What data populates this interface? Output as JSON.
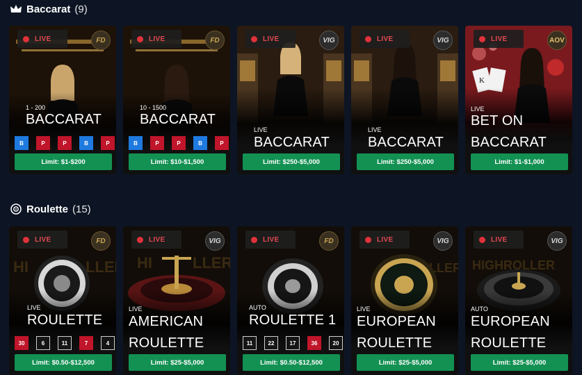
{
  "sections": {
    "baccarat": {
      "title": "Baccarat",
      "count": "(9)"
    },
    "roulette": {
      "title": "Roulette",
      "count": "(15)"
    }
  },
  "live_label": "LIVE",
  "baccarat_cards": [
    {
      "provider": "FD",
      "limit_line": "1 - 200",
      "name": "BACCARAT",
      "chips": [
        "B",
        "P",
        "P",
        "B",
        "P"
      ],
      "limit_button": "Limit: $1-$200"
    },
    {
      "provider": "FD",
      "limit_line": "10 - 1500",
      "name": "BACCARAT",
      "chips": [
        "B",
        "P",
        "P",
        "B",
        "P"
      ],
      "limit_button": "Limit: $10-$1,500"
    },
    {
      "provider": "VIG",
      "tag": "LIVE",
      "name": "BACCARAT",
      "limit_button": "Limit: $250-$5,000"
    },
    {
      "provider": "VIG",
      "tag": "LIVE",
      "name": "BACCARAT",
      "limit_button": "Limit: $250-$5,000"
    },
    {
      "provider": "AOV",
      "tag": "LIVE",
      "name_line1": "BET ON",
      "name_line2": "BACCARAT",
      "limit_button": "Limit: $1-$1,000"
    }
  ],
  "roulette_cards": [
    {
      "provider": "FD",
      "tag": "LIVE",
      "name": "ROULETTE",
      "numbers": [
        "30",
        "6",
        "11",
        "7",
        "4"
      ],
      "limit_button": "Limit: $0.50-$12,500"
    },
    {
      "provider": "VIG",
      "tag": "LIVE",
      "name_line1": "AMERICAN",
      "name_line2": "ROULETTE",
      "limit_button": "Limit: $25-$5,000"
    },
    {
      "provider": "FD",
      "tag": "AUTO",
      "name": "ROULETTE 1",
      "numbers": [
        "11",
        "22",
        "17",
        "36",
        "20"
      ],
      "limit_button": "Limit: $0.50-$12,500"
    },
    {
      "provider": "VIG",
      "tag": "LIVE",
      "name_line1": "EUROPEAN",
      "name_line2": "ROULETTE",
      "limit_button": "Limit: $25-$5,000"
    },
    {
      "provider": "VIG",
      "tag": "AUTO",
      "name_line1": "EUROPEAN",
      "name_line2": "ROULETTE",
      "limit_button": "Limit: $25-$5,000"
    }
  ],
  "icons": {
    "baccarat": "crown-icon",
    "roulette": "roulette-wheel-icon"
  },
  "colors": {
    "live_dot": "#e0323a",
    "limit_button": "#139153",
    "banker": "#1f7ae0",
    "player": "#c0152a",
    "background": "#0d1524"
  }
}
